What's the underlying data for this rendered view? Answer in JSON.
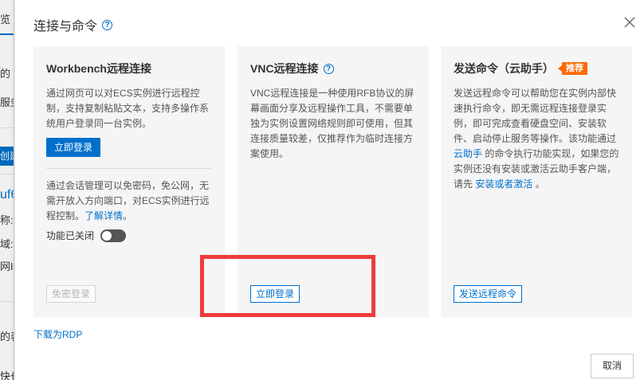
{
  "background": {
    "fragments": [
      "览",
      "的",
      "服务",
      "创建",
      "uf6",
      "称:",
      "域:",
      "网IP",
      "的表",
      "快也"
    ]
  },
  "modal": {
    "title": "连接与命令",
    "title_help_icon": "question-circle-icon",
    "close_icon": "close-icon",
    "cards": [
      {
        "title": "Workbench远程连接",
        "desc": "通过网页可以对ECS实例进行远程控制，支持复制粘贴文本，支持多操作系统用户登录同一台实例。",
        "button": "立即登录",
        "session_desc": "通过会话管理可以免密码，免公网，无需开放入方向端口，对ECS实例进行远程控制。",
        "session_link": "了解详情",
        "session_link_suffix": "。",
        "toggle_label": "功能已关闭",
        "toggle_state": "off",
        "footer_button": "免密登录"
      },
      {
        "title": "VNC远程连接",
        "help_icon": "question-circle-icon",
        "desc": "VNC远程连接是一种使用RFB协议的屏幕画面分享及远程操作工具，不需要单独为实例设置网络规则即可使用，但其连接质量较差，仅推荐作为临时连接方案使用。",
        "footer_button": "立即登录"
      },
      {
        "title": "发送命令（云助手）",
        "badge": "推荐",
        "desc_part1": "发送远程命令可以帮助您在实例内部快速执行命令，即无需远程连接登录实例，即可完成查看硬盘空间、安装软件、启动停止服务等操作。该功能通过",
        "desc_link1": "云助手",
        "desc_part2": "的命令执行功能实现，如果您的实例还没有安装或激活云助手客户端，请先",
        "desc_link2": "安装或者激活",
        "desc_part3": "。",
        "footer_button": "发送远程命令"
      }
    ],
    "rdp_link": "下载为RDP",
    "cancel_button": "取消"
  },
  "colors": {
    "accent": "#0070cc",
    "badge": "#ff6a00",
    "highlight": "#ef3b3b",
    "card_bg": "#f5f5f6"
  }
}
